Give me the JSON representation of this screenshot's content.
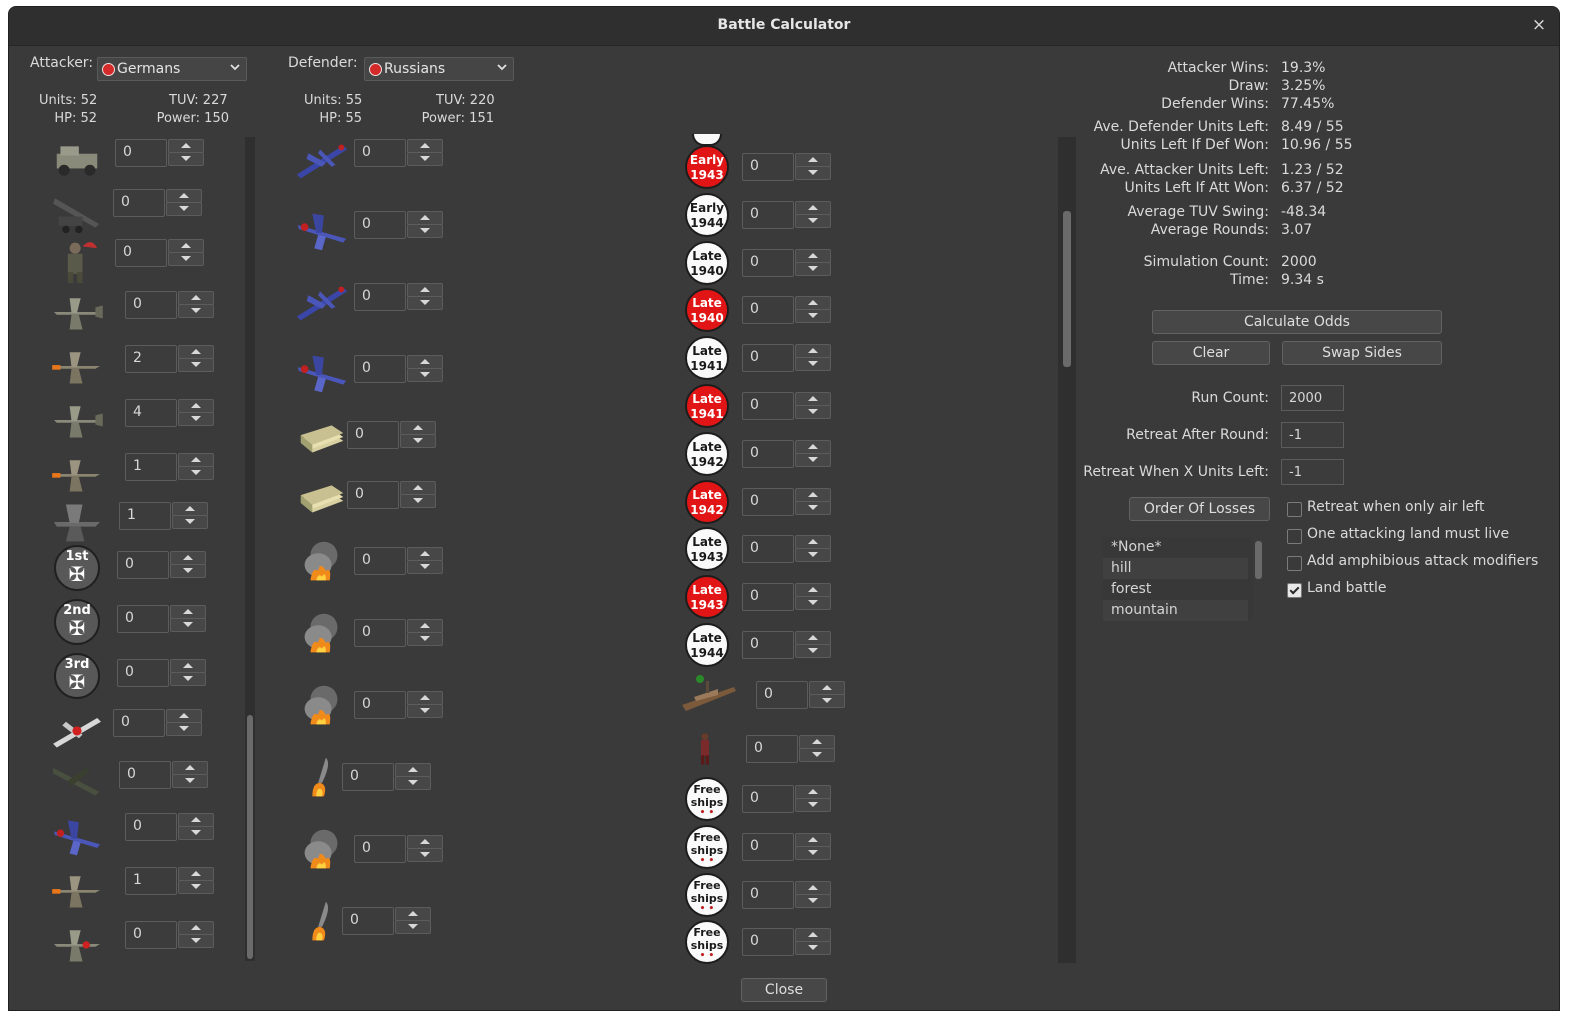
{
  "window": {
    "title": "Battle Calculator",
    "close_glyph": "×"
  },
  "attacker": {
    "label": "Attacker:",
    "nation": "Germans",
    "units_label": "Units: 52",
    "tuv_label": "TUV: 227",
    "hp_label": "HP: 52",
    "power_label": "Power: 150",
    "counts": [
      "0",
      "0",
      "0",
      "0",
      "2",
      "4",
      "1",
      "1",
      "0",
      "0",
      "0",
      "0",
      "0",
      "0",
      "1",
      "0"
    ],
    "medals": [
      "1st",
      "2nd",
      "3rd"
    ]
  },
  "defender": {
    "label": "Defender:",
    "nation": "Russians",
    "units_label": "Units: 55",
    "tuv_label": "TUV: 220",
    "hp_label": "HP: 55",
    "power_label": "Power: 151",
    "counts_left": [
      "0",
      "0",
      "0",
      "0",
      "0",
      "0",
      "0",
      "0",
      "0",
      "0",
      "0",
      "0"
    ],
    "coins": [
      {
        "line1": "Early",
        "line2": "1943",
        "color": "red"
      },
      {
        "line1": "Early",
        "line2": "1944",
        "color": "white"
      },
      {
        "line1": "Late",
        "line2": "1940",
        "color": "white"
      },
      {
        "line1": "Late",
        "line2": "1940",
        "color": "red"
      },
      {
        "line1": "Late",
        "line2": "1941",
        "color": "white"
      },
      {
        "line1": "Late",
        "line2": "1941",
        "color": "red"
      },
      {
        "line1": "Late",
        "line2": "1942",
        "color": "white"
      },
      {
        "line1": "Late",
        "line2": "1942",
        "color": "red"
      },
      {
        "line1": "Late",
        "line2": "1943",
        "color": "white"
      },
      {
        "line1": "Late",
        "line2": "1943",
        "color": "red"
      },
      {
        "line1": "Late",
        "line2": "1944",
        "color": "white"
      }
    ],
    "coin_counts": [
      "0",
      "0",
      "0",
      "0",
      "0",
      "0",
      "0",
      "0",
      "0",
      "0",
      "0"
    ],
    "ship_count": "0",
    "soldier_count": "0",
    "free_ships": {
      "line1": "Free",
      "line2": "ships"
    },
    "free_counts": [
      "0",
      "0",
      "0",
      "0"
    ]
  },
  "results": {
    "attacker_wins_label": "Attacker Wins:",
    "attacker_wins": "19.3%",
    "draw_label": "Draw:",
    "draw": "3.25%",
    "defender_wins_label": "Defender Wins:",
    "defender_wins": "77.45%",
    "ave_def_left_label": "Ave. Defender Units Left:",
    "ave_def_left": "8.49 / 55",
    "def_won_left_label": "Units Left If Def Won:",
    "def_won_left": "10.96 / 55",
    "ave_att_left_label": "Ave. Attacker Units Left:",
    "ave_att_left": "1.23 / 52",
    "att_won_left_label": "Units Left If Att Won:",
    "att_won_left": "6.37 / 52",
    "tuv_swing_label": "Average TUV Swing:",
    "tuv_swing": "-48.34",
    "avg_rounds_label": "Average Rounds:",
    "avg_rounds": "3.07",
    "sim_count_label": "Simulation Count:",
    "sim_count": "2000",
    "time_label": "Time:",
    "time": "9.34 s"
  },
  "buttons": {
    "calculate": "Calculate Odds",
    "clear": "Clear",
    "swap": "Swap Sides",
    "order_losses": "Order Of Losses",
    "close": "Close"
  },
  "settings": {
    "run_count_label": "Run Count:",
    "run_count": "2000",
    "retreat_round_label": "Retreat After Round:",
    "retreat_round": "-1",
    "retreat_units_label": "Retreat When X Units Left:",
    "retreat_units": "-1"
  },
  "terrain": [
    "*None*",
    "hill",
    "forest",
    "mountain"
  ],
  "checkboxes": [
    {
      "label": "Retreat when only air left",
      "checked": false
    },
    {
      "label": "One attacking land must live",
      "checked": false
    },
    {
      "label": "Add amphibious attack modifiers",
      "checked": false
    },
    {
      "label": "Land battle",
      "checked": true
    }
  ],
  "colors": {
    "background": "#3a3a3a",
    "coin_red": "#e11515",
    "coin_white": "#fafafa"
  }
}
